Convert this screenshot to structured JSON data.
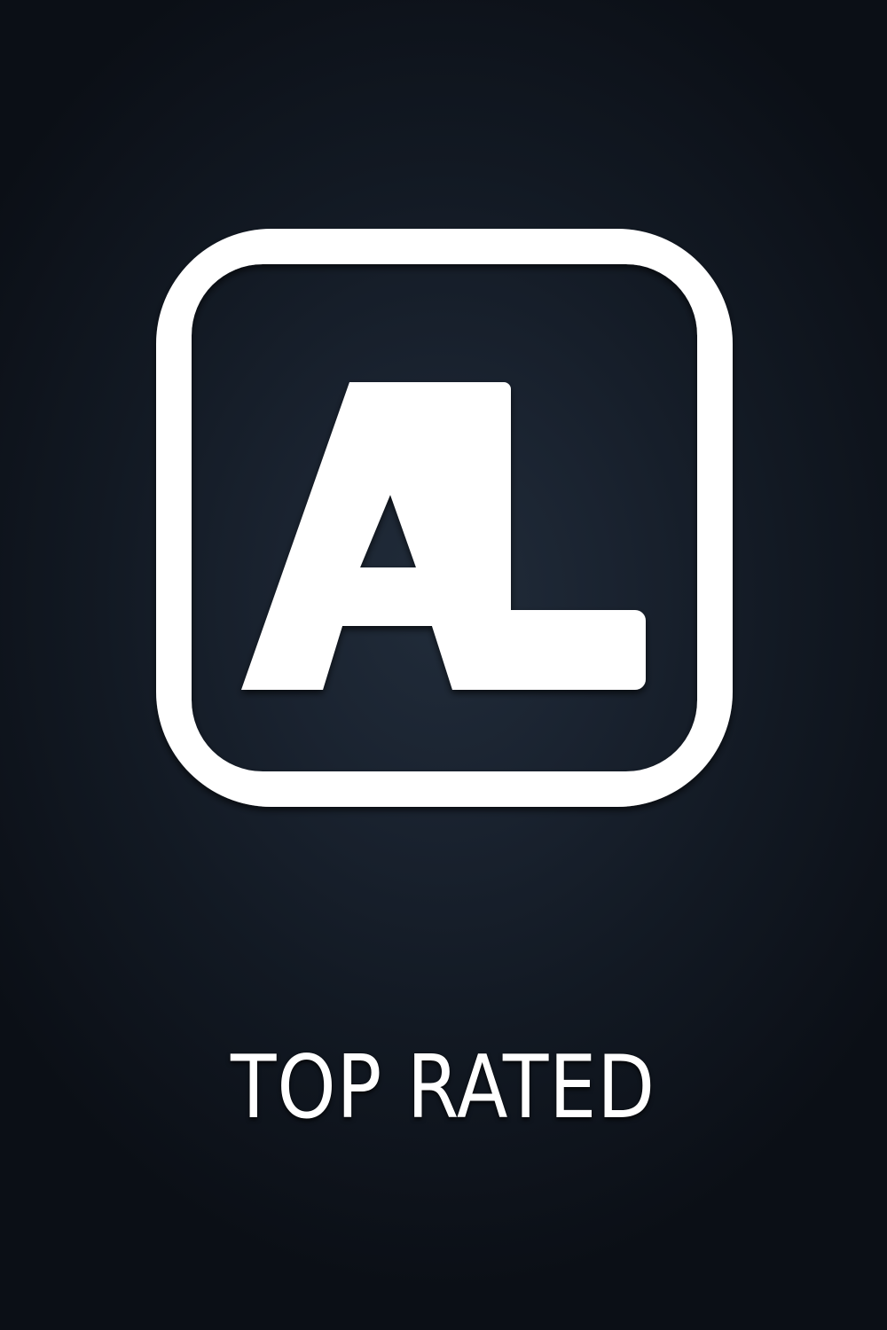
{
  "logo": {
    "text": "AL",
    "icon": "al-monogram-logo",
    "color": "#ffffff"
  },
  "caption": {
    "text": "TOP RATED"
  },
  "colors": {
    "background_center": "#212c3a",
    "background_edge": "#0b0f16",
    "foreground": "#ffffff"
  }
}
